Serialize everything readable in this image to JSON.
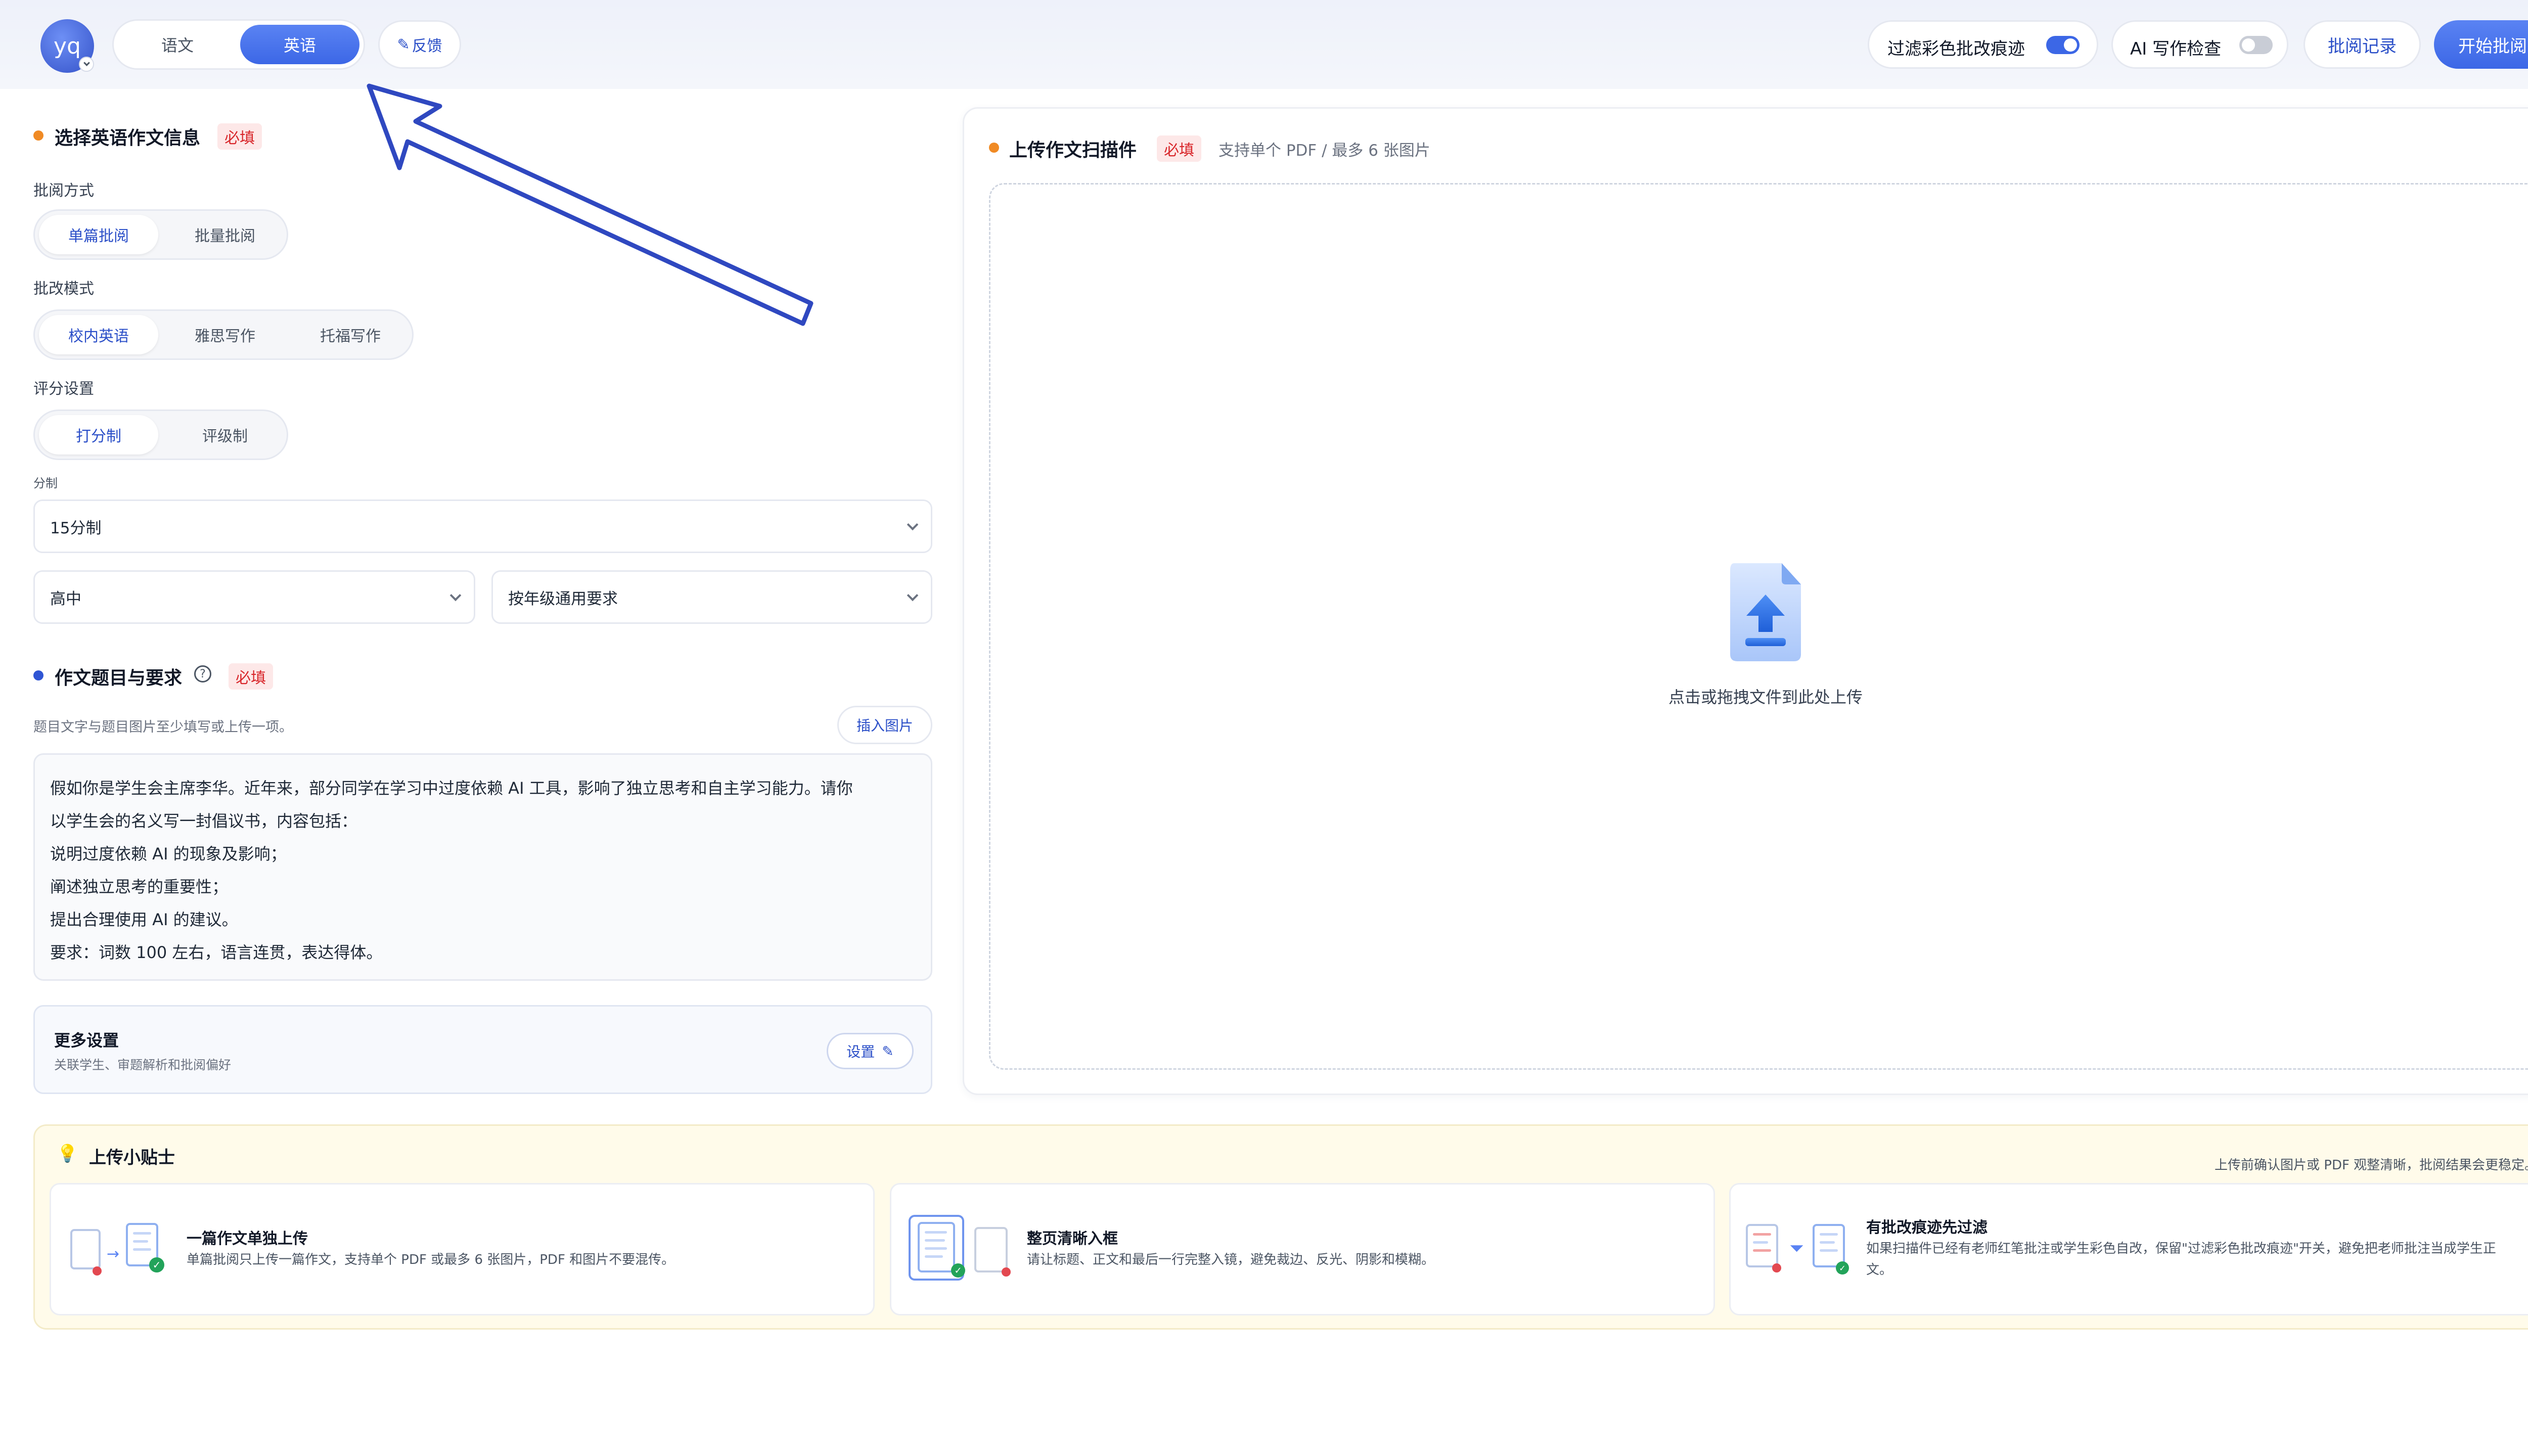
{
  "header": {
    "avatar_text": "yq",
    "tabs": [
      {
        "label": "语文",
        "active": false
      },
      {
        "label": "英语",
        "active": true
      }
    ],
    "feedback_label": "反馈",
    "toggles": [
      {
        "label": "过滤彩色批改痕迹",
        "on": true
      },
      {
        "label": "AI 写作检查",
        "on": false
      }
    ],
    "history_label": "批阅记录",
    "start_label": "开始批阅"
  },
  "left": {
    "section_title": "选择英语作文信息",
    "required": "必填",
    "review_method": {
      "label": "批阅方式",
      "options": [
        "单篇批阅",
        "批量批阅"
      ],
      "selected": "单篇批阅"
    },
    "review_mode": {
      "label": "批改模式",
      "options": [
        "校内英语",
        "雅思写作",
        "托福写作"
      ],
      "selected": "校内英语"
    },
    "scoring": {
      "label": "评分设置",
      "options": [
        "打分制",
        "评级制"
      ],
      "selected": "打分制"
    },
    "score_scale_label": "分制",
    "score_scale_value": "15分制",
    "grade_value": "高中",
    "requirement_value": "按年级通用要求",
    "prompt_section_title": "作文题目与要求",
    "prompt_hint": "题目文字与题目图片至少填写或上传一项。",
    "insert_image_label": "插入图片",
    "prompt_lines": [
      "假如你是学生会主席李华。近年来，部分同学在学习中过度依赖 AI 工具，影响了独立思考和自主学习能力。请你",
      "以学生会的名义写一封倡议书，内容包括：",
      "说明过度依赖 AI 的现象及影响；",
      "阐述独立思考的重要性；",
      "提出合理使用 AI 的建议。",
      "要求：词数 100 左右，语言连贯，表达得体。"
    ],
    "more_settings": {
      "title": "更多设置",
      "desc": "关联学生、审题解析和批阅偏好",
      "button": "设置"
    }
  },
  "right": {
    "title": "上传作文扫描件",
    "required": "必填",
    "hint": "支持单个 PDF / 最多 6 张图片",
    "drop_text": "点击或拖拽文件到此处上传"
  },
  "tips": {
    "title": "上传小贴士",
    "note": "上传前确认图片或 PDF 观整清晰，批阅结果会更稳定。",
    "cards": [
      {
        "title": "一篇作文单独上传",
        "desc": "单篇批阅只上传一篇作文，支持单个 PDF 或最多 6 张图片，PDF 和图片不要混传。"
      },
      {
        "title": "整页清晰入框",
        "desc": "请让标题、正文和最后一行完整入镜，避免裁边、反光、阴影和模糊。"
      },
      {
        "title": "有批改痕迹先过滤",
        "desc_lines": [
          "如果扫描件已经有老师红笔批注或学生彩色自改，保留\"过滤彩色批改痕迹\"开关，避免把老师批注当成学生正",
          "文。"
        ]
      }
    ]
  },
  "colors": {
    "accent": "#3c67e6",
    "required_text": "#d8262a",
    "orange_dot": "#f08a24",
    "blue_dot": "#2f55d4"
  }
}
